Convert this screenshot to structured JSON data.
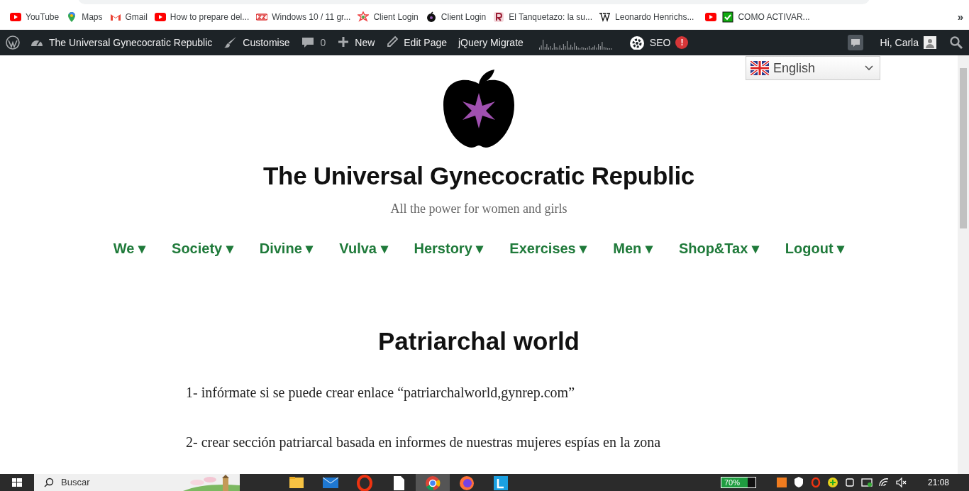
{
  "bookmarks": [
    {
      "label": "YouTube",
      "kind": "youtube"
    },
    {
      "label": "Maps",
      "kind": "maps"
    },
    {
      "label": "Gmail",
      "kind": "gmail"
    },
    {
      "label": "How to prepare del...",
      "kind": "youtube"
    },
    {
      "label": "Windows 10 / 11 gr...",
      "kind": "sz"
    },
    {
      "label": "Client Login",
      "kind": "star"
    },
    {
      "label": "Client Login",
      "kind": "apple"
    },
    {
      "label": "El Tanquetazo: la su...",
      "kind": "r"
    },
    {
      "label": "Leonardo Henrichs...",
      "kind": "wiki"
    },
    {
      "kind": "youtube"
    },
    {
      "label": "COMO ACTIVAR...",
      "kind": "check"
    }
  ],
  "bookmarks_more": "»",
  "admin_bar": {
    "items": [
      {
        "kind": "wp"
      },
      {
        "kind": "dashboard",
        "label": "The Universal Gynecocratic Republic"
      },
      {
        "kind": "brush",
        "label": "Customise"
      },
      {
        "kind": "comment",
        "label": "0"
      },
      {
        "kind": "plus",
        "label": "New"
      },
      {
        "kind": "pencil",
        "label": "Edit Page"
      },
      {
        "kind": "text",
        "label": "jQuery Migrate"
      },
      {
        "kind": "graph"
      },
      {
        "kind": "seo",
        "label": "SEO",
        "badge": "!"
      }
    ],
    "user": "Hi, Carla"
  },
  "language": {
    "value": "English"
  },
  "site": {
    "title": "The Universal Gynecocratic Republic",
    "tagline": "All the power for women and girls"
  },
  "menu": [
    {
      "label": "We ▾"
    },
    {
      "label": "Society ▾"
    },
    {
      "label": "Divine ▾"
    },
    {
      "label": "Vulva ▾"
    },
    {
      "label": "Herstory ▾"
    },
    {
      "label": "Exercises ▾"
    },
    {
      "label": "Men ▾"
    },
    {
      "label": "Shop&Tax ▾"
    },
    {
      "label": "Logout ▾"
    }
  ],
  "page": {
    "title": "Patriarchal world",
    "paragraphs": [
      "1- infórmate si se puede crear enlace “patriarchalworld,gynrep.com”",
      "2- crear sección patriarcal basada en informes de nuestras mujeres espías en la zona"
    ]
  },
  "taskbar": {
    "search_placeholder": "Buscar",
    "battery": "70%",
    "time": "21:08"
  }
}
